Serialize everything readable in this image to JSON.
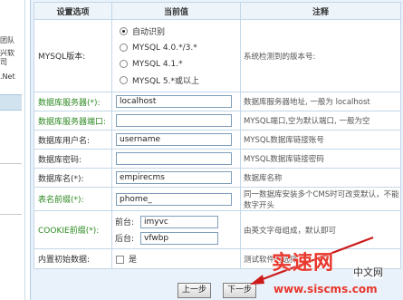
{
  "sidebar": {
    "fragments": [
      "团队",
      "兴软",
      "司",
      ".Net"
    ]
  },
  "table": {
    "headers": [
      "设置选项",
      "当前值",
      "注释"
    ]
  },
  "rows": {
    "mysql": {
      "label": "MYSQL版本:",
      "options": [
        "自动识别",
        "MYSQL 4.0.*/3.*",
        "MYSQL 4.1.*",
        "MYSQL 5.*或以上"
      ],
      "note": "系统检测到的版本号:"
    },
    "server": {
      "label": "数据库服务器(*):",
      "value": "localhost",
      "note": "数据库服务器地址, 一般为 localhost"
    },
    "port": {
      "label": "数据库服务器端口:",
      "value": "",
      "note": "MYSQL端口,空为默认端口, 一般为空"
    },
    "user": {
      "label": "数据库用户名:",
      "value": "username",
      "note": "MYSQL数据库链接账号"
    },
    "password": {
      "label": "数据库密码:",
      "value": "",
      "note": "MYSQL数据库链接密码"
    },
    "dbname": {
      "label": "数据库名(*):",
      "value": "empirecms",
      "note": "数据库名称"
    },
    "prefix": {
      "label": "表名前缀(*):",
      "value": "phome_",
      "note": "同一数据库安装多个CMS时可改变默认，不能数字开头"
    },
    "cookie": {
      "label": "COOKIE前缀(*):",
      "front_label": "前台:",
      "front_value": "imyvc",
      "back_label": "后台:",
      "back_value": "vfwbp",
      "note": "由英文字母组成，默认即可"
    },
    "initdata": {
      "label": "内置初始数据:",
      "check_label": "是",
      "note": "测试软件时选择"
    }
  },
  "buttons": {
    "prev": "上一步",
    "next": "下一步"
  },
  "watermark": {
    "big": "实速网",
    "side": "中文网",
    "url": "www.siscms.com"
  },
  "colors": {
    "green_label": "#2f8a23",
    "panel_bg": "#e9f2fa",
    "arrow": "#cc1a1a"
  }
}
